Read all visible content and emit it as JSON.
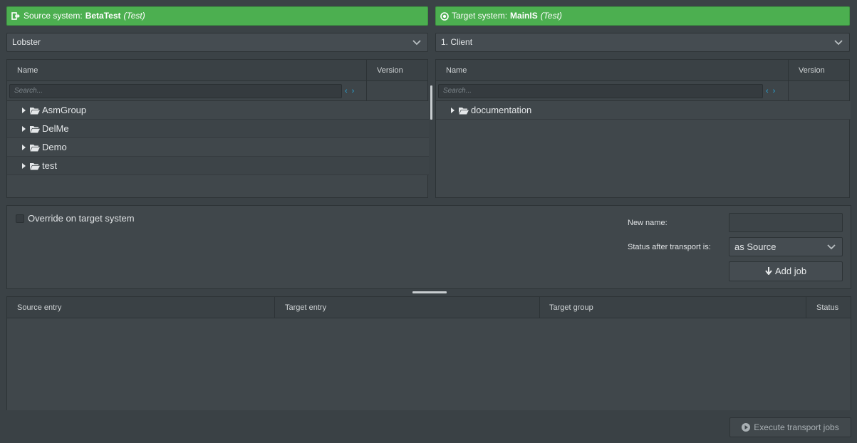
{
  "source": {
    "label": "Source system:",
    "name": "BetaTest",
    "env": "(Test)",
    "select_value": "Lobster",
    "tree": {
      "col_name": "Name",
      "col_version": "Version",
      "search_placeholder": "Search...",
      "nav_prev": "‹",
      "nav_next": "›",
      "items": [
        {
          "label": "AsmGroup"
        },
        {
          "label": "DelMe"
        },
        {
          "label": "Demo"
        },
        {
          "label": "test"
        }
      ]
    }
  },
  "target": {
    "label": "Target system:",
    "name": "MainIS",
    "env": "(Test)",
    "select_value": "1. Client",
    "tree": {
      "col_name": "Name",
      "col_version": "Version",
      "search_placeholder": "Search...",
      "nav_prev": "‹",
      "nav_next": "›",
      "items": [
        {
          "label": "documentation"
        }
      ]
    }
  },
  "options": {
    "override_label": "Override on target system",
    "new_name_label": "New name:",
    "new_name_value": "",
    "status_label": "Status after transport is:",
    "status_value": "as Source",
    "add_job_label": "Add job"
  },
  "jobs": {
    "columns": [
      "Source entry",
      "Target entry",
      "Target group",
      "Status"
    ]
  },
  "footer": {
    "execute_label": "Execute transport jobs"
  },
  "colors": {
    "accent_green": "#4caf50",
    "nav_arrow_blue": "#2aa7d8"
  },
  "icons": {
    "source": "sign-out-icon",
    "target": "dot-circle-icon",
    "folder": "folder-open-icon",
    "add_job": "arrow-down-icon",
    "execute": "play-circle-icon"
  }
}
